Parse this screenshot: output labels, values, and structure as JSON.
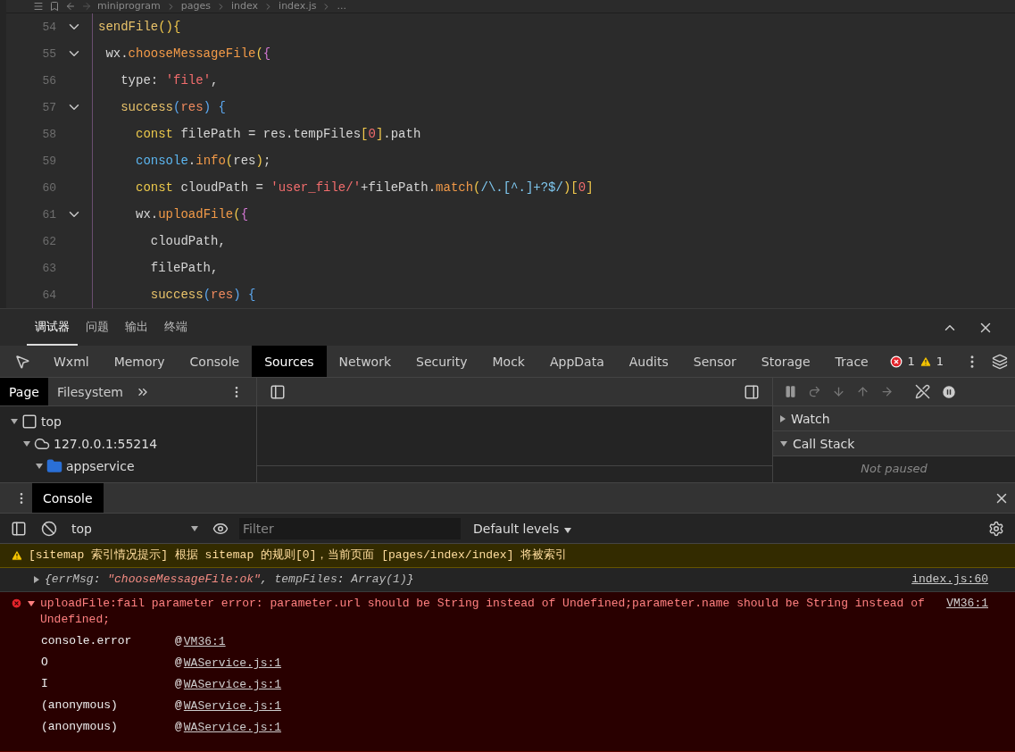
{
  "editor": {
    "breadcrumb": [
      "miniprogram",
      "pages",
      "index",
      "index.js",
      "..."
    ],
    "lines": [
      {
        "number": "54",
        "foldable": true,
        "tokens": [
          {
            "t": "sendFile",
            "kind": "fn"
          },
          {
            "t": "()",
            "kind": "b1"
          },
          {
            "t": "{",
            "kind": "b1"
          }
        ]
      },
      {
        "number": "55",
        "foldable": true,
        "tokens": [
          {
            "t": " wx.",
            "kind": "plain"
          },
          {
            "t": "chooseMessageFile",
            "kind": "call"
          },
          {
            "t": "(",
            "kind": "b1"
          },
          {
            "t": "{",
            "kind": "b2"
          }
        ]
      },
      {
        "number": "56",
        "foldable": false,
        "tokens": [
          {
            "t": "   type: ",
            "kind": "plain"
          },
          {
            "t": "'file'",
            "kind": "str"
          },
          {
            "t": ",",
            "kind": "plain"
          }
        ]
      },
      {
        "number": "57",
        "foldable": true,
        "tokens": [
          {
            "t": "   success",
            "kind": "fn"
          },
          {
            "t": "(",
            "kind": "b3"
          },
          {
            "t": "res",
            "kind": "param"
          },
          {
            "t": ")",
            "kind": "b3"
          },
          {
            "t": " {",
            "kind": "b3"
          }
        ]
      },
      {
        "number": "58",
        "foldable": false,
        "tokens": [
          {
            "t": "     const",
            "kind": "kw"
          },
          {
            "t": " filePath = res.tempFiles",
            "kind": "plain"
          },
          {
            "t": "[",
            "kind": "b1"
          },
          {
            "t": "0",
            "kind": "num"
          },
          {
            "t": "]",
            "kind": "b1"
          },
          {
            "t": ".path",
            "kind": "plain"
          }
        ]
      },
      {
        "number": "59",
        "foldable": false,
        "tokens": [
          {
            "t": "     console",
            "kind": "obj"
          },
          {
            "t": ".",
            "kind": "plain"
          },
          {
            "t": "info",
            "kind": "call"
          },
          {
            "t": "(",
            "kind": "b1"
          },
          {
            "t": "res",
            "kind": "plain"
          },
          {
            "t": ")",
            "kind": "b1"
          },
          {
            "t": ";",
            "kind": "plain"
          }
        ]
      },
      {
        "number": "60",
        "foldable": false,
        "tokens": [
          {
            "t": "     const",
            "kind": "kw"
          },
          {
            "t": " cloudPath = ",
            "kind": "plain"
          },
          {
            "t": "'user_file/'",
            "kind": "str"
          },
          {
            "t": "+filePath.",
            "kind": "plain"
          },
          {
            "t": "match",
            "kind": "call"
          },
          {
            "t": "(",
            "kind": "b1"
          },
          {
            "t": "/\\.[^.]+?$/",
            "kind": "regex"
          },
          {
            "t": ")",
            "kind": "b1"
          },
          {
            "t": "[",
            "kind": "b1"
          },
          {
            "t": "0",
            "kind": "num"
          },
          {
            "t": "]",
            "kind": "b1"
          }
        ]
      },
      {
        "number": "61",
        "foldable": true,
        "tokens": [
          {
            "t": "     wx.",
            "kind": "plain"
          },
          {
            "t": "uploadFile",
            "kind": "call"
          },
          {
            "t": "(",
            "kind": "b1"
          },
          {
            "t": "{",
            "kind": "b2"
          }
        ]
      },
      {
        "number": "62",
        "foldable": false,
        "tokens": [
          {
            "t": "       cloudPath,",
            "kind": "plain"
          }
        ]
      },
      {
        "number": "63",
        "foldable": false,
        "tokens": [
          {
            "t": "       filePath,",
            "kind": "plain"
          }
        ]
      },
      {
        "number": "64",
        "foldable": false,
        "tokens": [
          {
            "t": "       success",
            "kind": "fn"
          },
          {
            "t": "(",
            "kind": "b3"
          },
          {
            "t": "res",
            "kind": "param"
          },
          {
            "t": ")",
            "kind": "b3"
          },
          {
            "t": " {",
            "kind": "b3"
          }
        ]
      }
    ]
  },
  "panel_tabs": [
    {
      "label": "调试器",
      "selected": true
    },
    {
      "label": "问题",
      "selected": false
    },
    {
      "label": "输出",
      "selected": false
    },
    {
      "label": "终端",
      "selected": false
    }
  ],
  "devtools_tabs": [
    {
      "label": "Wxml",
      "selected": false
    },
    {
      "label": "Memory",
      "selected": false
    },
    {
      "label": "Console",
      "selected": false
    },
    {
      "label": "Sources",
      "selected": true
    },
    {
      "label": "Network",
      "selected": false
    },
    {
      "label": "Security",
      "selected": false
    },
    {
      "label": "Mock",
      "selected": false
    },
    {
      "label": "AppData",
      "selected": false
    },
    {
      "label": "Audits",
      "selected": false
    },
    {
      "label": "Sensor",
      "selected": false
    },
    {
      "label": "Storage",
      "selected": false
    },
    {
      "label": "Trace",
      "selected": false
    }
  ],
  "error_count": "1",
  "warning_count": "1",
  "sources": {
    "nav_tabs": [
      {
        "label": "Page",
        "selected": true
      },
      {
        "label": "Filesystem",
        "selected": false
      }
    ],
    "tree": [
      {
        "label": "top",
        "kind": "frame",
        "expanded": true,
        "children": [
          {
            "label": "127.0.0.1:55214",
            "kind": "cloud",
            "expanded": true,
            "children": [
              {
                "label": "appservice",
                "kind": "folder",
                "expanded": true
              }
            ]
          }
        ]
      }
    ],
    "sections": [
      {
        "label": "Watch",
        "expanded": false
      },
      {
        "label": "Call Stack",
        "expanded": true
      }
    ],
    "status": "Not paused"
  },
  "console": {
    "tab": {
      "label": "Console",
      "selected": true
    },
    "context": "top",
    "filter_placeholder": "Filter",
    "levels": "Default levels",
    "messages": [
      {
        "kind": "warning",
        "text": "[sitemap 索引情况提示] 根据 sitemap 的规则[0]，当前页面 [pages/index/index] 将被索引"
      },
      {
        "kind": "log",
        "expanded": false,
        "tokens": [
          {
            "t": "{",
            "kind": "plain"
          },
          {
            "t": "errMsg",
            "kind": "key"
          },
          {
            "t": ": ",
            "kind": "plain"
          },
          {
            "t": "\"chooseMessageFile:ok\"",
            "kind": "str"
          },
          {
            "t": ", ",
            "kind": "plain"
          },
          {
            "t": "tempFiles",
            "kind": "key"
          },
          {
            "t": ": ",
            "kind": "plain"
          },
          {
            "t": "Array(1)",
            "kind": "val"
          },
          {
            "t": "}",
            "kind": "plain"
          }
        ],
        "source": "index.js:60"
      },
      {
        "kind": "error",
        "expanded": true,
        "text": "uploadFile:fail parameter error: parameter.url should be String instead of Undefined;parameter.name should be String instead of Undefined;",
        "source": "VM36:1",
        "stack": [
          {
            "fn": "console.error",
            "at": "@",
            "source": "VM36:1"
          },
          {
            "fn": "O",
            "at": "@",
            "source": "WAService.js:1"
          },
          {
            "fn": "I",
            "at": "@",
            "source": "WAService.js:1"
          },
          {
            "fn": "(anonymous)",
            "at": "@",
            "source": "WAService.js:1"
          },
          {
            "fn": "(anonymous)",
            "at": "@",
            "source": "WAService.js:1"
          }
        ]
      }
    ]
  }
}
